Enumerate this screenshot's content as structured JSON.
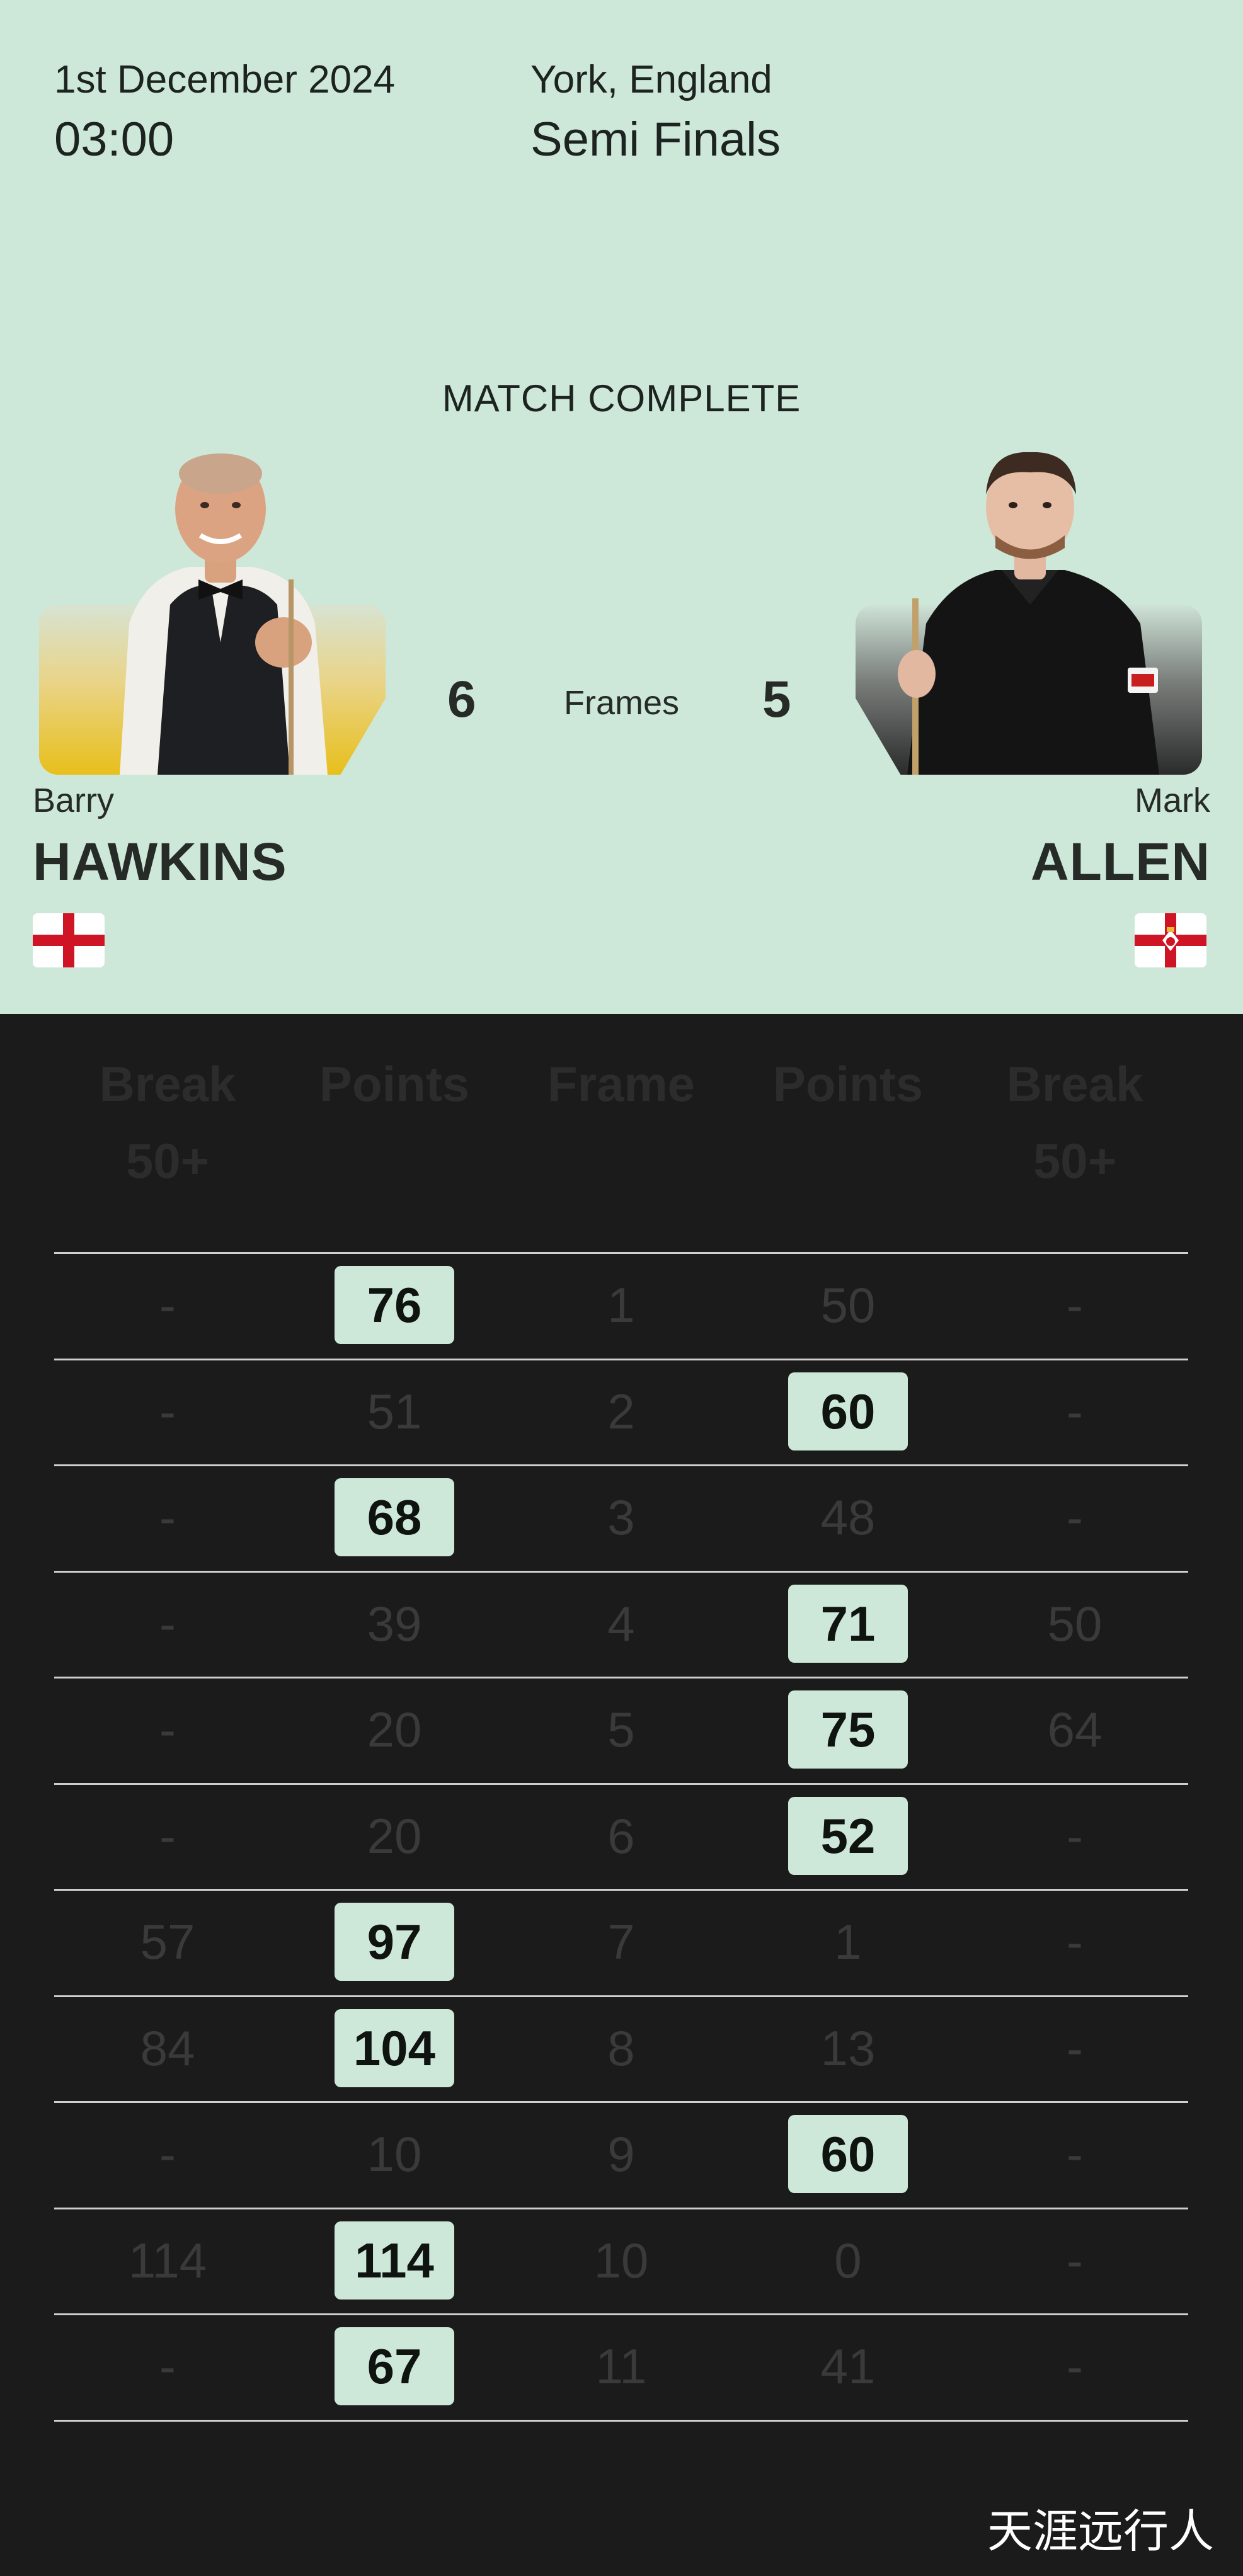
{
  "match": {
    "date": "1st December 2024",
    "time": "03:00",
    "location": "York, England",
    "round": "Semi Finals",
    "status": "MATCH COMPLETE",
    "frames_label": "Frames"
  },
  "players": {
    "left": {
      "first_name": "Barry",
      "last_name": "HAWKINS",
      "frames": "6",
      "flag": "england-flag-icon"
    },
    "right": {
      "first_name": "Mark",
      "last_name": "ALLEN",
      "frames": "5",
      "flag": "northern-ireland-flag-icon"
    }
  },
  "table": {
    "headers": {
      "left_break_1": "Break",
      "left_break_2": "50+",
      "left_points": "Points",
      "frame": "Frame",
      "right_points": "Points",
      "right_break_1": "Break",
      "right_break_2": "50+"
    },
    "rows": [
      {
        "left_break": "-",
        "left_points": "76",
        "frame": "1",
        "right_points": "50",
        "right_break": "-",
        "winner": "left"
      },
      {
        "left_break": "-",
        "left_points": "51",
        "frame": "2",
        "right_points": "60",
        "right_break": "-",
        "winner": "right"
      },
      {
        "left_break": "-",
        "left_points": "68",
        "frame": "3",
        "right_points": "48",
        "right_break": "-",
        "winner": "left"
      },
      {
        "left_break": "-",
        "left_points": "39",
        "frame": "4",
        "right_points": "71",
        "right_break": "50",
        "winner": "right"
      },
      {
        "left_break": "-",
        "left_points": "20",
        "frame": "5",
        "right_points": "75",
        "right_break": "64",
        "winner": "right"
      },
      {
        "left_break": "-",
        "left_points": "20",
        "frame": "6",
        "right_points": "52",
        "right_break": "-",
        "winner": "right"
      },
      {
        "left_break": "57",
        "left_points": "97",
        "frame": "7",
        "right_points": "1",
        "right_break": "-",
        "winner": "left"
      },
      {
        "left_break": "84",
        "left_points": "104",
        "frame": "8",
        "right_points": "13",
        "right_break": "-",
        "winner": "left"
      },
      {
        "left_break": "-",
        "left_points": "10",
        "frame": "9",
        "right_points": "60",
        "right_break": "-",
        "winner": "right"
      },
      {
        "left_break": "114",
        "left_points": "114",
        "frame": "10",
        "right_points": "0",
        "right_break": "-",
        "winner": "left"
      },
      {
        "left_break": "-",
        "left_points": "67",
        "frame": "11",
        "right_points": "41",
        "right_break": "-",
        "winner": "left"
      }
    ]
  },
  "watermark": "天涯远行人",
  "colors": {
    "header_bg": "#cde8d8",
    "table_bg": "#1b1b1b",
    "winner_chip": "#cde8d8"
  }
}
